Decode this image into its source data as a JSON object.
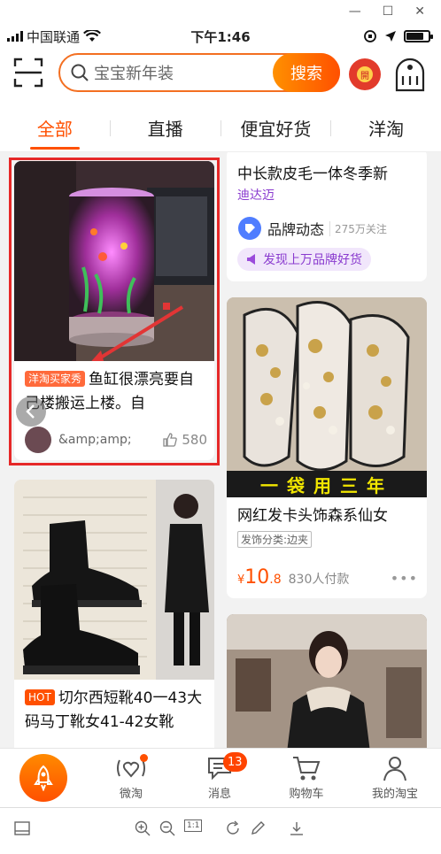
{
  "status_bar": {
    "carrier": "中国联通",
    "time": "下午1:46",
    "battery_level": 0.8
  },
  "search": {
    "placeholder": "宝宝新年装",
    "button": "搜索"
  },
  "icons": {
    "scan": "scan-icon",
    "search": "search-icon",
    "camera": "camera-icon",
    "red_packet": "red-packet-icon",
    "messages": "message-box-icon"
  },
  "red_packet": {
    "label": "開"
  },
  "tabs": [
    {
      "label": "全部",
      "active": true
    },
    {
      "label": "直播",
      "active": false
    },
    {
      "label": "便宜好货",
      "active": false
    },
    {
      "label": "洋淘",
      "active": false
    }
  ],
  "feed": {
    "left": [
      {
        "tag": "洋淘买家秀",
        "title": "鱼缸很漂亮要自己楼搬运上楼。自",
        "user": "&amp;amp;",
        "likes": "580"
      },
      {
        "tag": "HOT",
        "title": "切尔西短靴40一43大码马丁靴女41-42女靴"
      }
    ],
    "right": [
      {
        "title": "中长款皮毛一体冬季新",
        "brand": "迪达迈",
        "channel": "品牌动态",
        "followers": "275万关注",
        "promo": "发现上万品牌好货"
      },
      {
        "overlay": "一袋用三年",
        "title": "网红发卡头饰森系仙女",
        "category": "发饰分类:边夹",
        "price_symbol": "¥",
        "price_int": "10",
        "price_dec": ".8",
        "buyers": "830人付款"
      },
      {
        "title": ""
      }
    ]
  },
  "tabbar": {
    "items": [
      {
        "label": "微淘"
      },
      {
        "label": "消息",
        "badge": "13"
      },
      {
        "label": "购物车"
      },
      {
        "label": "我的淘宝"
      }
    ]
  },
  "viewer": {
    "fit_label": "1:1"
  },
  "colors": {
    "accent": "#ff5000",
    "highlight": "#e62828",
    "price": "#ff5000"
  }
}
